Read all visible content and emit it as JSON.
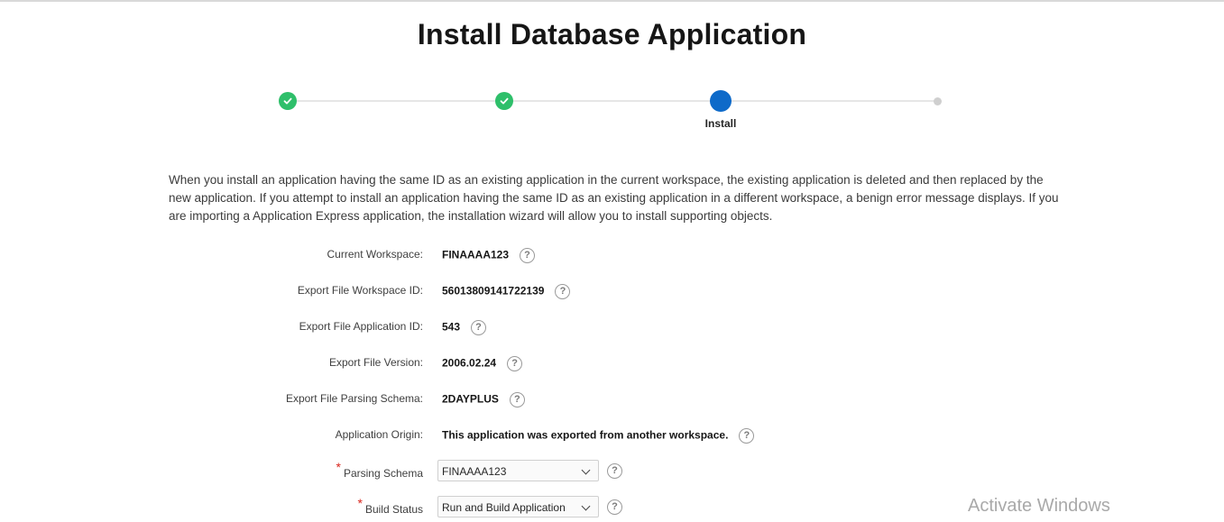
{
  "page": {
    "title": "Install Database Application"
  },
  "wizard": {
    "steps": [
      {
        "state": "done",
        "label": ""
      },
      {
        "state": "done",
        "label": ""
      },
      {
        "state": "current",
        "label": "Install"
      },
      {
        "state": "future",
        "label": ""
      }
    ]
  },
  "description": "When you install an application having the same ID as an existing application in the current workspace, the existing application is deleted and then replaced by the new application. If you attempt to install an application having the same ID as an existing application in a different workspace, a benign error message displays. If you are importing a Application Express application, the installation wizard will allow you to install supporting objects.",
  "fields": {
    "current_workspace": {
      "label": "Current Workspace:",
      "value": "FINAAAA123"
    },
    "export_workspace_id": {
      "label": "Export File Workspace ID:",
      "value": "56013809141722139"
    },
    "export_application_id": {
      "label": "Export File Application ID:",
      "value": "543"
    },
    "export_version": {
      "label": "Export File Version:",
      "value": "2006.02.24"
    },
    "export_parsing_schema": {
      "label": "Export File Parsing Schema:",
      "value": "2DAYPLUS"
    },
    "application_origin": {
      "label": "Application Origin:",
      "value": "This application was exported from another workspace."
    },
    "parsing_schema": {
      "label": "Parsing Schema",
      "value": "FINAAAA123",
      "required_mark": "*"
    },
    "build_status": {
      "label": "Build Status",
      "value": "Run and Build Application",
      "required_mark": "*"
    }
  },
  "help_glyph": "?",
  "icons": {
    "help": "help-icon",
    "check": "check-icon",
    "dropdown": "chevron-down-icon"
  },
  "colors": {
    "done": "#2ebf6a",
    "current": "#0e6ac9",
    "future": "#cfcfcf",
    "required": "#d9251c"
  },
  "watermark": "Activate Windows"
}
